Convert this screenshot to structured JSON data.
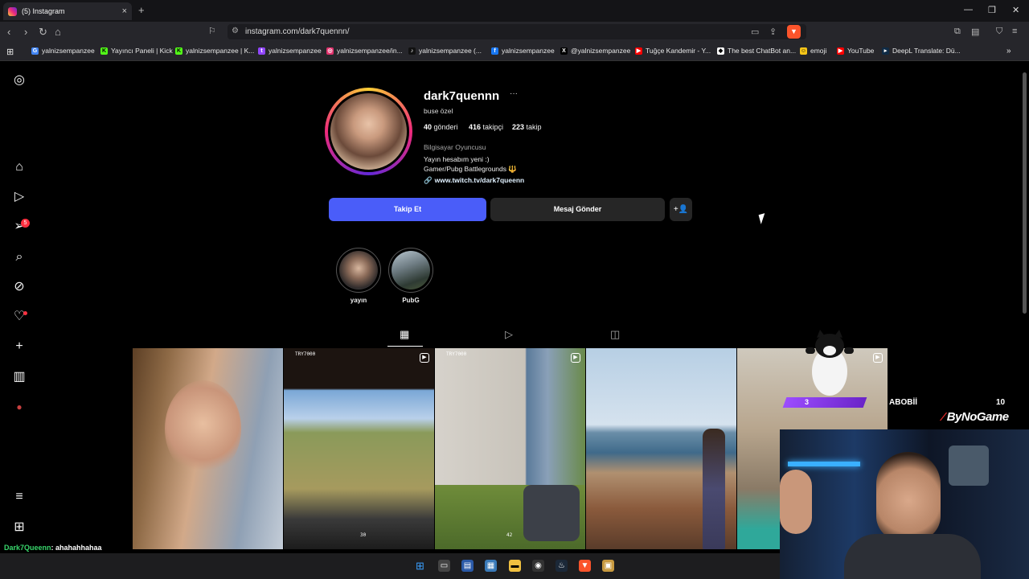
{
  "browser": {
    "tab_title": "(5) Instagram",
    "new_tab": "+",
    "url": "instagram.com/dark7quennn/",
    "bookmarks": [
      {
        "label": "yalnizsempanzee",
        "color": "#4285f4",
        "glyph": "G"
      },
      {
        "label": "Yayıncı Paneli | Kick",
        "color": "#53fc18",
        "glyph": "K"
      },
      {
        "label": "yalnizsempanzee | K...",
        "color": "#53fc18",
        "glyph": "K"
      },
      {
        "label": "yalnizsempanzee",
        "color": "#9146ff",
        "glyph": "t"
      },
      {
        "label": "yalnizsempanzee/in...",
        "color": "#e1306c",
        "glyph": "◎"
      },
      {
        "label": "yalnizsempanzee (...",
        "color": "#111",
        "glyph": "♪"
      },
      {
        "label": "yalnizsempanzee",
        "color": "#1877f2",
        "glyph": "f"
      },
      {
        "label": "@yalnizsempanzee",
        "color": "#000",
        "glyph": "X"
      },
      {
        "label": "Tuğçe Kandemir - Y...",
        "color": "#ff0000",
        "glyph": "▶"
      },
      {
        "label": "The best ChatBot an...",
        "color": "#fff",
        "glyph": "◆"
      },
      {
        "label": "emoji",
        "color": "#f5c518",
        "glyph": "☺"
      },
      {
        "label": "YouTube",
        "color": "#ff0000",
        "glyph": "▶"
      },
      {
        "label": "DeepL Translate: Dü...",
        "color": "#0f2b46",
        "glyph": "▸"
      }
    ]
  },
  "profile": {
    "username": "dark7quennn",
    "more": "···",
    "full_name": "buse özel",
    "posts_count": "40",
    "posts_label": "gönderi",
    "followers_count": "416",
    "followers_label": "takipçi",
    "following_count": "223",
    "following_label": "takip",
    "category": "Bilgisayar Oyuncusu",
    "bio_line1": "Yayın hesabım yeni :)",
    "bio_line2": "Gamer/Pubg Battlegrounds 🔱",
    "link": "www.twitch.tv/dark7queenn",
    "follow_button": "Takip Et",
    "message_button": "Mesaj Gönder",
    "suggest_button": "+👤"
  },
  "highlights": [
    {
      "label": "yayın"
    },
    {
      "label": "PubG"
    }
  ],
  "posts": [
    {
      "hud": ""
    },
    {
      "hud": "TRY7000"
    },
    {
      "hud": "TRY7000"
    },
    {
      "hud": ""
    },
    {
      "hud": ""
    }
  ],
  "post_hud": {
    "ammo1": "30",
    "ammo2": "42"
  },
  "stream": {
    "sub_count": "3",
    "name": "ABOBİİ",
    "score": "10",
    "brand": "ByNoGame",
    "chat_user": "Dark7Queenn",
    "chat_message": ": ahahahhahaa"
  },
  "sidebar": {
    "notification_count": "5"
  },
  "colors": {
    "follow_blue": "#4a5df9",
    "badge_red": "#ff3040",
    "sub_purple": "#9c4dff",
    "chat_green": "#38d66b"
  }
}
